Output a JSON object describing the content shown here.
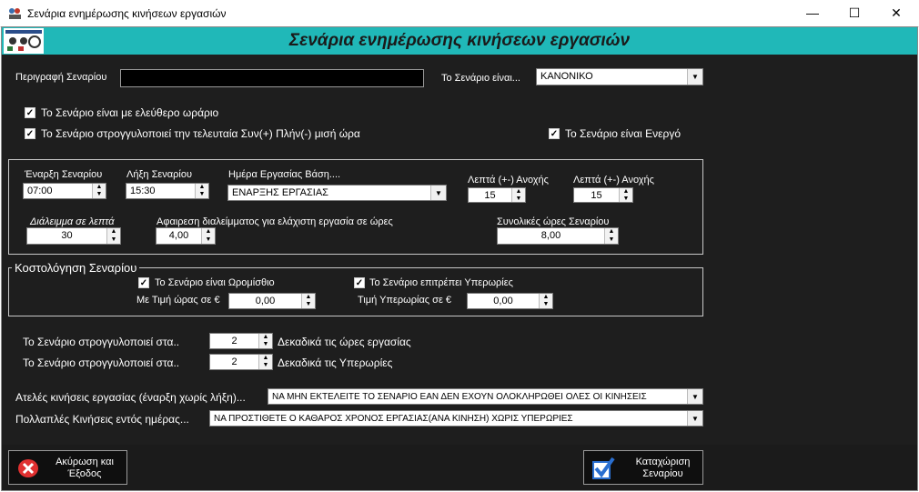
{
  "window": {
    "title": "Σενάρια ενημέρωσης κινήσεων εργασιών"
  },
  "header": {
    "title": "Σενάρια ενημέρωσης κινήσεων εργασιών"
  },
  "description": {
    "label": "Περιγραφή Σεναρίου",
    "value": ""
  },
  "scenario_type": {
    "label": "Το Σενάριο είναι...",
    "value": "ΚΑΝΟΝΙΚΟ"
  },
  "checks": {
    "free_hours": "Το Σενάριο είναι με ελεύθερο ωράριο",
    "round_last": "Το Σενάριο στρογγυλοποιεί την τελευταία Συν(+) Πλήν(-) μισή ώρα",
    "active": "Το Σενάριο είναι Ενεργό"
  },
  "times": {
    "start_label": "Έναρξη Σεναρίου",
    "start_value": "07:00",
    "end_label": "Λήξη Σεναρίου",
    "end_value": "15:30",
    "day_label": "Ημέρα Εργασίας Βάση....",
    "day_value": "ΕΝΑΡΞΗΣ ΕΡΓΑΣΙΑΣ",
    "tol1_label": "Λεπτά (+-) Ανοχής",
    "tol1_value": "15",
    "tol2_label": "Λεπτά (+-) Ανοχής",
    "tol2_value": "15",
    "break_label": "Διάλειμμα σε λεπτά",
    "break_value": "30",
    "deduct_label": "Αφαιρεση διαλείμματος για ελάχιστη εργασία σε ώρες",
    "deduct_value": "4,00",
    "total_label": "Συνολικές ώρες Σεναρίου",
    "total_value": "8,00"
  },
  "costing": {
    "legend": "Κοστολόγηση Σεναρίου",
    "hourly_label": "Το Σενάριο είναι Ωρομίσθιο",
    "overtime_allowed_label": "Το Σενάριο επιτρέπει Υπερωρίες",
    "rate_label": "Με Τιμή ώρας σε €",
    "rate_value": "0,00",
    "ot_rate_label": "Τιμή Υπερωρίας σε €",
    "ot_rate_value": "0,00"
  },
  "rounding": {
    "row1_label": "Το Σενάριο στρογγυλοποιεί στα..",
    "row1_value": "2",
    "row1_suffix": "Δεκαδικά τις ώρες εργασίας",
    "row2_label": "Το Σενάριο στρογγυλοποιεί στα..",
    "row2_value": "2",
    "row2_suffix": "Δεκαδικά τις Υπερωρίες"
  },
  "incomplete": {
    "label": "Ατελές κινήσεις εργασίας (έναρξη χωρίς λήξη)...",
    "value": "ΝΑ ΜΗΝ ΕΚΤΕΛΕΙΤΕ ΤΟ ΣΕΝΑΡΙΟ ΕΑΝ ΔΕΝ ΕΧΟΥΝ ΟΛΟΚΛΗΡΩΘΕΙ ΟΛΕΣ ΟΙ ΚΙΝΗΣΕΙΣ"
  },
  "multiple": {
    "label": "Πολλαπλές Κινήσεις εντός ημέρας...",
    "value": "ΝΑ ΠΡΟΣΤΙΘΕΤΕ Ο ΚΑΘΑΡΟΣ ΧΡΟΝΟΣ ΕΡΓΑΣΙΑΣ(ΑΝΑ ΚΙΝΗΣΗ) ΧΩΡΙΣ ΥΠΕΡΩΡΙΕΣ"
  },
  "footer": {
    "cancel_line1": "Ακύρωση και",
    "cancel_line2": "Έξοδος",
    "save_line1": "Καταχώριση",
    "save_line2": "Σεναρίου"
  },
  "colors": {
    "accent": "#20b8b8",
    "background": "#1e1e1e",
    "cancel_icon": "#e03030",
    "save_icon": "#2a6fd0"
  }
}
